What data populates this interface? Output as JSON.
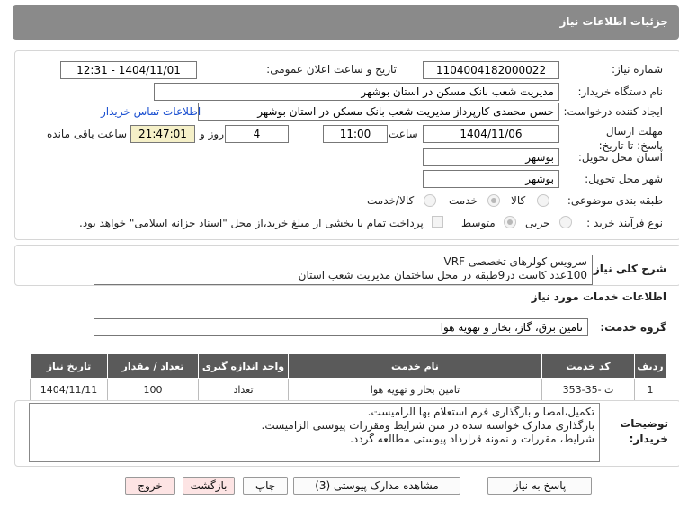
{
  "header": {
    "title": "جزئیات اطلاعات نیاز"
  },
  "form": {
    "need_number_label": "شماره نیاز:",
    "need_number": "1104004182000022",
    "announce_label": "تاریخ و ساعت اعلان عمومی:",
    "announce_value": "1404/11/01 - 12:31",
    "buyer_label": "نام دستگاه خریدار:",
    "buyer_value": "مدیریت شعب بانک مسکن در استان بوشهر",
    "creator_label": "ایجاد کننده درخواست:",
    "creator_value": "حسن محمدی کارپرداز مدیریت شعب بانک مسکن در استان بوشهر",
    "contact_link": "اطلاعات تماس خریدار",
    "deadline_label": "مهلت ارسال پاسخ: تا تاریخ:",
    "deadline_date": "1404/11/06",
    "time_label": "ساعت",
    "deadline_time": "11:00",
    "days_value": "4",
    "days_label": "روز و",
    "remaining_time": "21:47:01",
    "remaining_label": "ساعت باقی مانده",
    "province_label": "استان محل تحویل:",
    "province_value": "بوشهر",
    "city_label": "شهر محل تحویل:",
    "city_value": "بوشهر",
    "category_label": "طبقه بندی موضوعی:",
    "category_options": [
      "کالا",
      "خدمت",
      "کالا/خدمت"
    ],
    "category_selected": "خدمت",
    "process_label": "نوع فرآیند خرید :",
    "process_options": [
      "جزیی",
      "متوسط"
    ],
    "process_selected": "متوسط",
    "payment_note": "پرداخت تمام یا بخشی از مبلغ خرید،از محل \"اسناد خزانه اسلامی\" خواهد بود."
  },
  "description": {
    "label": "شرح کلی نیاز:",
    "line1": "سرویس کولرهای تخصصی VRF",
    "line2": "100عدد کاست در9طبقه در محل ساختمان مدیریت شعب استان"
  },
  "services": {
    "section_title": "اطلاعات خدمات مورد نیاز",
    "group_label": "گروه خدمت:",
    "group_value": "تامین برق، گاز، بخار و تهویه هوا",
    "columns": [
      "ردیف",
      "کد خدمت",
      "نام خدمت",
      "واحد اندازه گیری",
      "تعداد / مقدار",
      "تاریخ نیاز"
    ],
    "rows": [
      {
        "row": "1",
        "code": "ت -35-353",
        "name": "تامین بخار و تهویه هوا",
        "unit": "تعداد",
        "qty": "100",
        "date": "1404/11/11"
      }
    ]
  },
  "notes": {
    "label": "توضیحات خریدار:",
    "line1": "تکمیل،امضا و بارگذاری فرم استعلام بها الزامیست.",
    "line2": "بارگذاری مدارک خواسته شده در متن شرایط ومقررات پیوستی الزامیست.",
    "line3": "شرایط، مقررات و نمونه قرارداد پیوستی مطالعه گردد."
  },
  "buttons": {
    "reply": "پاسخ به نیاز",
    "attachments": "مشاهده مدارک پیوستی (3)",
    "print": "چاپ",
    "back": "بازگشت",
    "exit": "خروج"
  },
  "colors": {
    "header_bg": "#8a8a8a",
    "table_header_bg": "#5a5a5a",
    "link": "#1a4fd0",
    "remaining_bg": "#f5f0c8",
    "pink_button": "#fde4e4"
  }
}
